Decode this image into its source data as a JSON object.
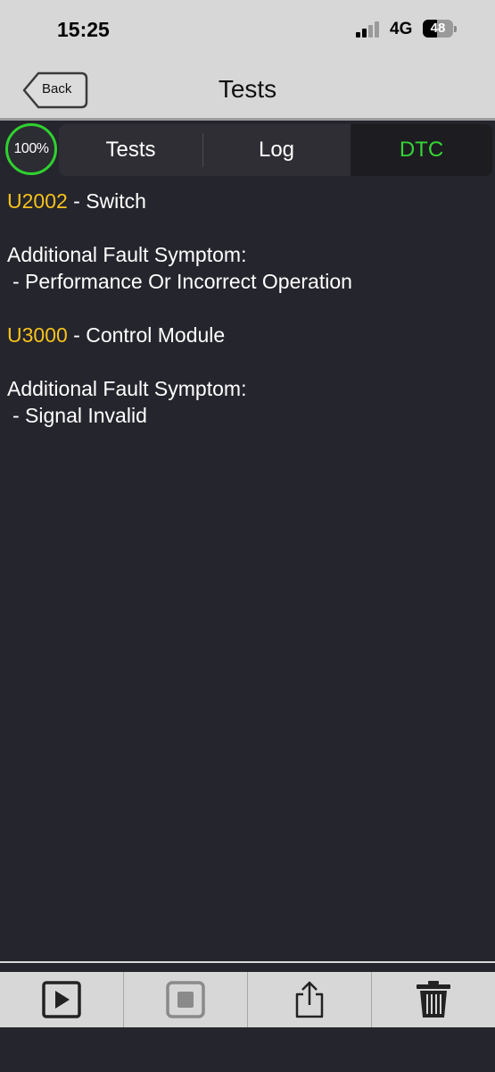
{
  "status": {
    "time": "15:25",
    "network": "4G",
    "battery_level": "48",
    "battery_fraction": 0.48
  },
  "nav": {
    "back_label": "Back",
    "title": "Tests"
  },
  "progress": {
    "label": "100%"
  },
  "tabs": [
    {
      "label": "Tests",
      "active": false
    },
    {
      "label": "Log",
      "active": false
    },
    {
      "label": "DTC",
      "active": true
    }
  ],
  "dtcs": [
    {
      "code": "U2002",
      "description": " - Switch",
      "symptom_header": "Additional Fault Symptom:",
      "symptom": " - Performance Or Incorrect Operation"
    },
    {
      "code": "U3000",
      "description": " - Control Module",
      "symptom_header": "Additional Fault Symptom:",
      "symptom": " - Signal Invalid"
    }
  ],
  "toolbar": {
    "buttons": [
      "play-icon",
      "stop-icon",
      "share-icon",
      "trash-icon"
    ]
  },
  "colors": {
    "accent_green": "#35d435",
    "code_yellow": "#f6c21c",
    "background": "#25252d",
    "bar_gray": "#d7d7d7"
  }
}
